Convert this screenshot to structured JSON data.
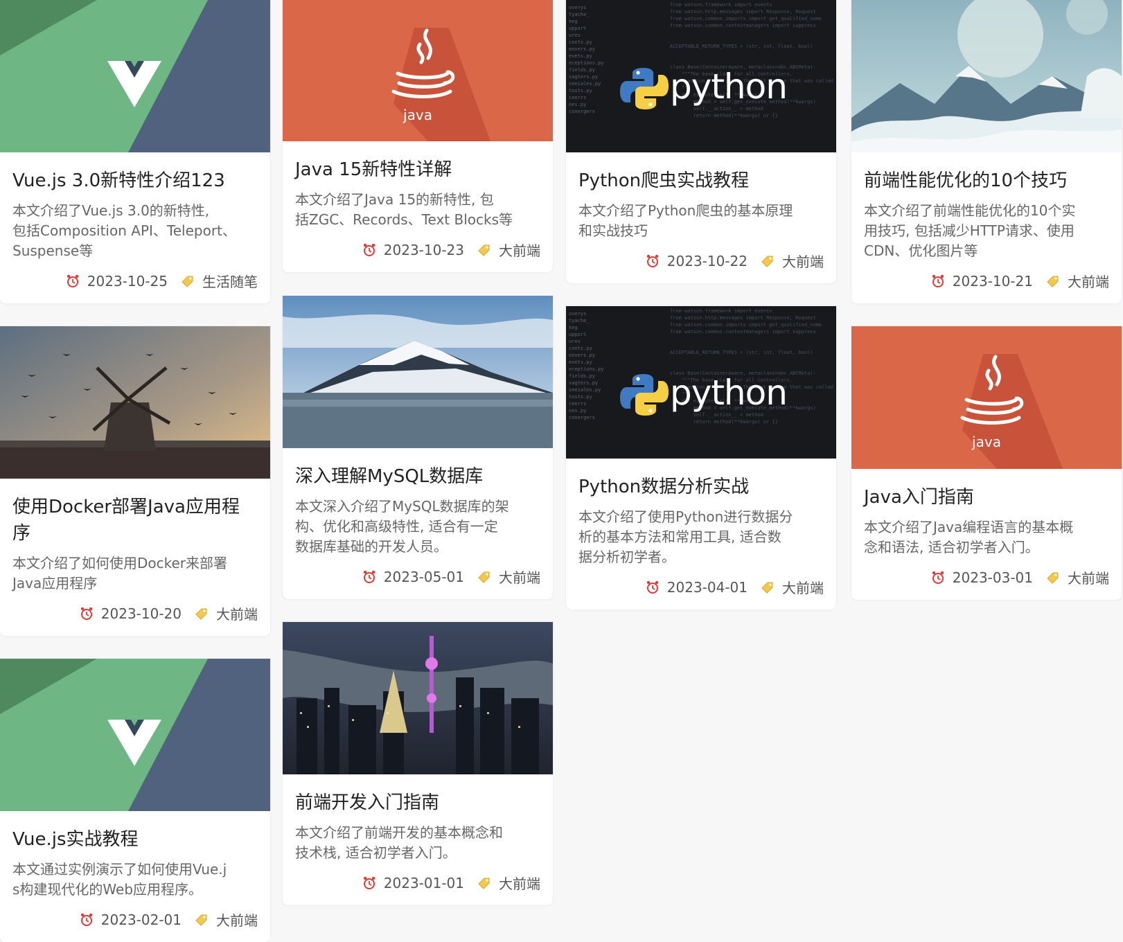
{
  "meta_icons": {
    "date": "alarm-clock-icon",
    "category": "tag-icon"
  },
  "colors": {
    "vue_green": "#6eb785",
    "vue_navy": "#51627e",
    "java_orange": "#da6747",
    "python_dark": "#17191d"
  },
  "cards": [
    {
      "title": "Vue.js 3.0新特性介绍123",
      "desc_lines": [
        "本文介绍了Vue.js 3.0的新特性,",
        "包括Composition API、Teleport、",
        "Suspense等"
      ],
      "date": "2023-10-25",
      "category": "生活随笔",
      "cover": "vue"
    },
    {
      "title": "Java 15新特性详解",
      "desc_lines": [
        "本文介绍了Java 15的新特性, 包",
        "括ZGC、Records、Text Blocks等"
      ],
      "date": "2023-10-23",
      "category": "大前端",
      "cover": "java",
      "cover_text": "java"
    },
    {
      "title": "Python爬虫实战教程",
      "desc_lines": [
        "本文介绍了Python爬虫的基本原理",
        "和实战技巧"
      ],
      "date": "2023-10-22",
      "category": "大前端",
      "cover": "python",
      "cover_text": "python"
    },
    {
      "title": "前端性能优化的10个技巧",
      "desc_lines": [
        "本文介绍了前端性能优化的10个实",
        "用技巧, 包括减少HTTP请求、使用",
        "CDN、优化图片等"
      ],
      "date": "2023-10-21",
      "category": "大前端",
      "cover": "moon-mountains"
    },
    {
      "title_lines": [
        "使用Docker部署Java应用程",
        "序"
      ],
      "desc_lines": [
        "本文介绍了如何使用Docker来部署",
        "Java应用程序"
      ],
      "date": "2023-10-20",
      "category": "大前端",
      "cover": "windmill-sunset"
    },
    {
      "title": "深入理解MySQL数据库",
      "desc_lines": [
        "本文深入介绍了MySQL数据库的架",
        "构、优化和高级特性, 适合有一定",
        "数据库基础的开发人员。"
      ],
      "date": "2023-05-01",
      "category": "大前端",
      "cover": "snow-mountain"
    },
    {
      "title": "Python数据分析实战",
      "desc_lines": [
        "本文介绍了使用Python进行数据分",
        "析的基本方法和常用工具, 适合数",
        "据分析初学者。"
      ],
      "date": "2023-04-01",
      "category": "大前端",
      "cover": "python",
      "cover_text": "python"
    },
    {
      "title": "Java入门指南",
      "desc_lines": [
        "本文介绍了Java编程语言的基本概",
        "念和语法, 适合初学者入门。"
      ],
      "date": "2023-03-01",
      "category": "大前端",
      "cover": "java",
      "cover_text": "java"
    },
    {
      "title": "Vue.js实战教程",
      "desc_lines": [
        "本文通过实例演示了如何使用Vue.j",
        "s构建现代化的Web应用程序。"
      ],
      "date": "2023-02-01",
      "category": "大前端",
      "cover": "vue"
    },
    {
      "title": "前端开发入门指南",
      "desc_lines": [
        "本文介绍了前端开发的基本概念和",
        "技术栈, 适合初学者入门。"
      ],
      "date": "2023-01-01",
      "category": "大前端",
      "cover": "city-night"
    }
  ]
}
